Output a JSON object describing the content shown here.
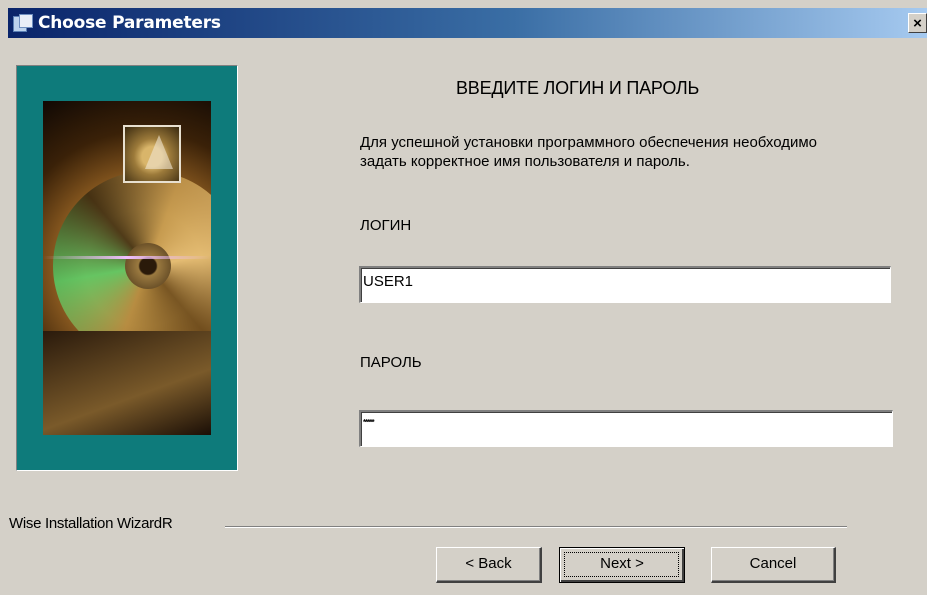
{
  "window": {
    "title": "Choose Parameters",
    "close_label": "×"
  },
  "content": {
    "heading": "ВВЕДИТЕ ЛОГИН И ПАРОЛЬ",
    "description": "Для успешной установки программного обеспечения необходимо задать корректное имя пользователя и пароль.",
    "login_label": "ЛОГИН",
    "login_value": "USER1",
    "password_label": "ПАРОЛЬ",
    "password_value": "*****"
  },
  "footer": {
    "brand": "Wise Installation WizardR",
    "back_label": "< Back",
    "next_label": "Next >",
    "cancel_label": "Cancel"
  },
  "colors": {
    "titlebar_start": "#0a246a",
    "titlebar_end": "#a6caf0",
    "dialog_bg": "#d4d0c8",
    "banner_bg": "#0e7b7b"
  },
  "icons": [
    "setup-app-icon",
    "close-icon",
    "installer-disc-image"
  ]
}
